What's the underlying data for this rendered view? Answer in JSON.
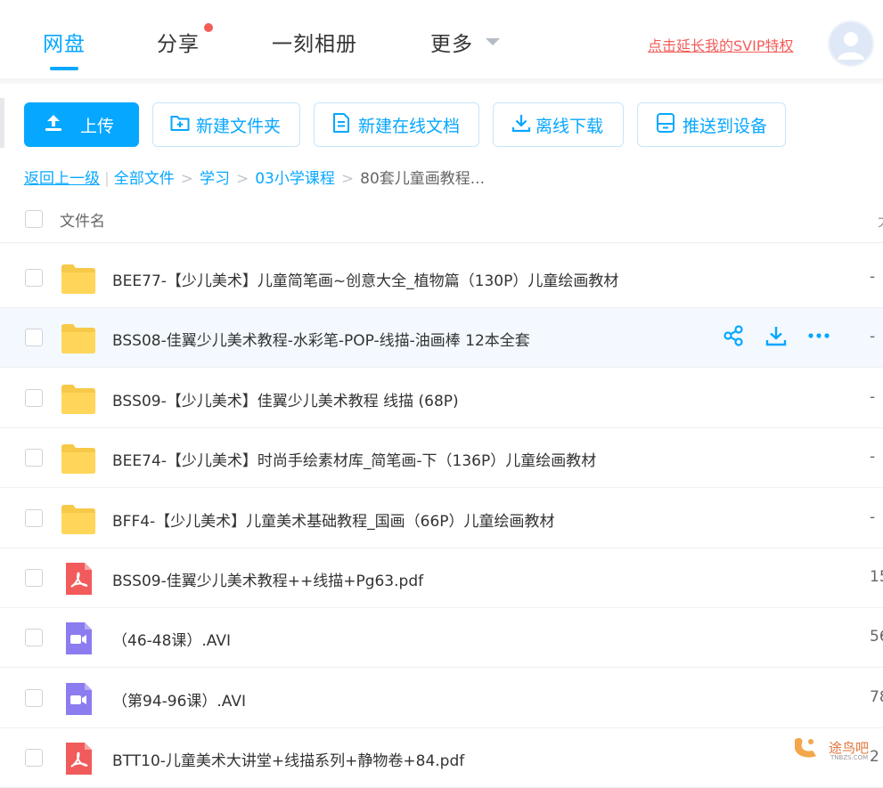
{
  "nav": {
    "items": [
      {
        "label": "网盘",
        "active": true
      },
      {
        "label": "分享",
        "badge_dot": true
      },
      {
        "label": "一刻相册"
      },
      {
        "label": "更多",
        "has_dropdown": true
      }
    ],
    "promo_link": "点击延长我的SVIP特权",
    "avatar_icon": "user-avatar-icon"
  },
  "toolbar": {
    "upload": "上传",
    "new_folder": "新建文件夹",
    "new_doc": "新建在线文档",
    "offline_download": "离线下载",
    "push_device": "推送到设备"
  },
  "breadcrumb": {
    "back": "返回上一级",
    "items": [
      "全部文件",
      "学习",
      "03小学课程"
    ],
    "current": "80套儿童画教程..."
  },
  "table": {
    "header_name": "文件名",
    "header_right": "大",
    "rows": [
      {
        "name": "BEE77-【少儿美术】儿童简笔画~创意大全_植物篇（130P）儿童绘画教材",
        "type": "folder",
        "size": "-"
      },
      {
        "name": "BSS08-佳翼少儿美术教程-水彩笔-POP-线描-油画棒 12本全套",
        "type": "folder",
        "size": "-",
        "hover": true
      },
      {
        "name": "BSS09-【少儿美术】佳翼少儿美术教程 线描 (68P)",
        "type": "folder",
        "size": "-"
      },
      {
        "name": "BEE74-【少儿美术】时尚手绘素材库_简笔画-下（136P）儿童绘画教材",
        "type": "folder",
        "size": "-"
      },
      {
        "name": "BFF4-【少儿美术】儿童美术基础教程_国画（66P）儿童绘画教材",
        "type": "folder",
        "size": "-"
      },
      {
        "name": "BSS09-佳翼少儿美术教程++线描+Pg63.pdf",
        "type": "pdf",
        "size": "15"
      },
      {
        "name": "（46-48课）.AVI",
        "type": "video",
        "size": "56"
      },
      {
        "name": "（第94-96课）.AVI",
        "type": "video",
        "size": "78"
      },
      {
        "name": "BTT10-儿童美术大讲堂+线描系列+静物卷+84.pdf",
        "type": "pdf",
        "size": "2"
      }
    ],
    "row_actions": [
      "share-icon",
      "download-icon",
      "more-icon"
    ]
  },
  "watermark": {
    "text": "途鸟吧",
    "sub": "TNBZS.COM"
  },
  "colors": {
    "accent": "#06a7ff",
    "promo": "#f25d59",
    "folder": "#ffd659",
    "pdf": "#f15b5b",
    "video": "#8b7cf0"
  }
}
